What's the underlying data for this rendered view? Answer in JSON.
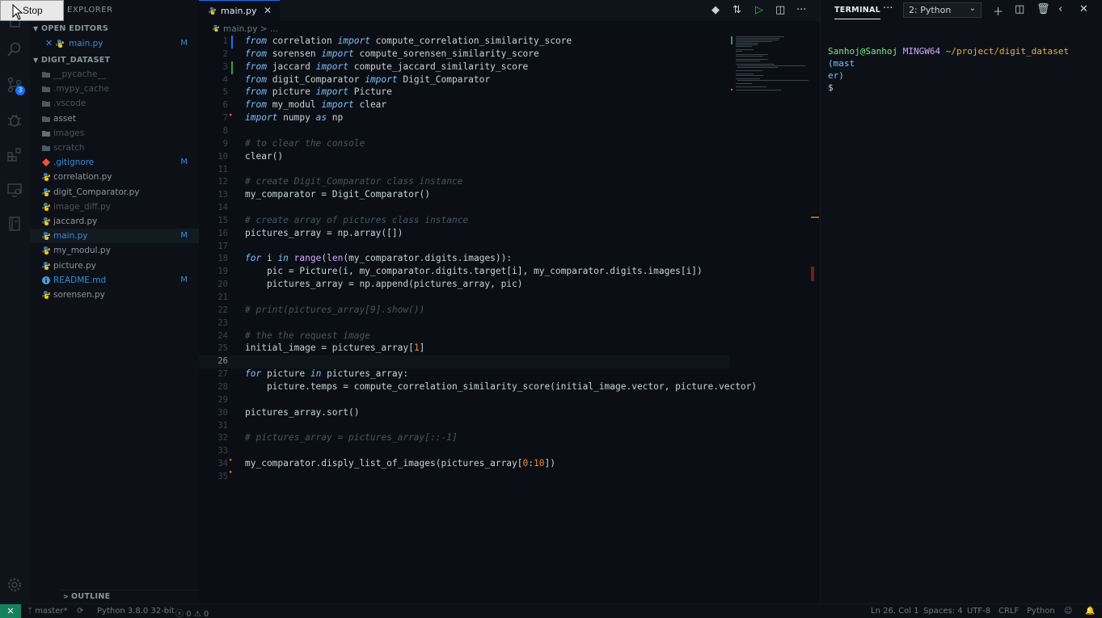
{
  "explorer": {
    "title": "EXPLORER",
    "open_editors_label": "OPEN EDITORS",
    "open_editor_file": "main.py",
    "open_editor_status": "M",
    "project_label": "DIGIT_DATASET",
    "outline_label": "OUTLINE",
    "source_control_badge": "3",
    "files": [
      {
        "name": "__pycache__",
        "status": "",
        "icon": "folder-icon"
      },
      {
        "name": ".mypy_cache",
        "status": "",
        "icon": "folder-icon"
      },
      {
        "name": ".vscode",
        "status": "",
        "icon": "folder-icon"
      },
      {
        "name": "asset",
        "status": "",
        "icon": "folder-icon"
      },
      {
        "name": "images",
        "status": "",
        "icon": "folder-image-icon"
      },
      {
        "name": "scratch",
        "status": "",
        "icon": "folder-icon"
      },
      {
        "name": ".gitignore",
        "status": "M",
        "icon": "git-icon"
      },
      {
        "name": "correlation.py",
        "status": "",
        "icon": "python-icon"
      },
      {
        "name": "digit_Comparator.py",
        "status": "",
        "icon": "python-icon"
      },
      {
        "name": "image_diff.py",
        "status": "",
        "icon": "python-icon"
      },
      {
        "name": "jaccard.py",
        "status": "",
        "icon": "python-icon"
      },
      {
        "name": "main.py",
        "status": "M",
        "icon": "python-icon"
      },
      {
        "name": "my_modul.py",
        "status": "",
        "icon": "python-icon"
      },
      {
        "name": "picture.py",
        "status": "",
        "icon": "python-icon"
      },
      {
        "name": "README.md",
        "status": "M",
        "icon": "info-icon"
      },
      {
        "name": "sorensen.py",
        "status": "",
        "icon": "python-icon"
      }
    ]
  },
  "overlay": {
    "stop_label": "Stop"
  },
  "editor": {
    "tab_label": "main.py",
    "tab_close": "✕",
    "breadcrumb_file": "main.py",
    "breadcrumb_rest": "> ..."
  },
  "code_lines": [
    "from correlation import compute_correlation_similarity_score",
    "from sorensen import compute_sorensen_similarity_score",
    "from jaccard import compute_jaccard_similarity_score",
    "from digit_Comparator import Digit_Comparator",
    "from picture import Picture",
    "from my_modul import clear",
    "import numpy as np",
    "",
    "# to clear the console",
    "clear()",
    "",
    "# create Digit_Comparator class instance",
    "my_comparator = Digit_Comparator()",
    "",
    "# create array of pictures class instance",
    "pictures_array = np.array([])",
    "",
    "for i in range(len(my_comparator.digits.images)):",
    "    pic = Picture(i, my_comparator.digits.target[i], my_comparator.digits.images[i])",
    "    pictures_array = np.append(pictures_array, pic)",
    "",
    "# print(pictures_array[9].show())",
    "",
    "# the the request image",
    "initial_image = pictures_array[1]",
    "",
    "for picture in pictures_array:",
    "    picture.temps = compute_correlation_similarity_score(initial_image.vector, picture.vector)",
    "",
    "pictures_array.sort()",
    "",
    "# pictures_array = pictures_array[::-1]",
    "",
    "my_comparator.disply_list_of_images(pictures_array[0:10])",
    ""
  ],
  "terminal": {
    "title": "TERMINAL",
    "more": "···",
    "selected_shell": "2: Python",
    "prompt_user": "Sanhoj@Sanhoj",
    "prompt_host": "MINGW64",
    "prompt_path": "~/project/digit_dataset",
    "prompt_branch_1": "(mast",
    "prompt_branch_2": "er)",
    "prompt_symbol": "$"
  },
  "status": {
    "branch": "master*",
    "interpreter": "Python 3.8.0 32-bit",
    "errors": "0",
    "warnings": "0",
    "cursor": "Ln 26, Col 1",
    "spaces": "Spaces: 4",
    "encoding": "UTF-8",
    "eol": "CRLF",
    "language": "Python"
  },
  "colors": {
    "accent": "#1f6feb",
    "remote_indicator": "#16825d",
    "modified": "#3a8bd6"
  }
}
